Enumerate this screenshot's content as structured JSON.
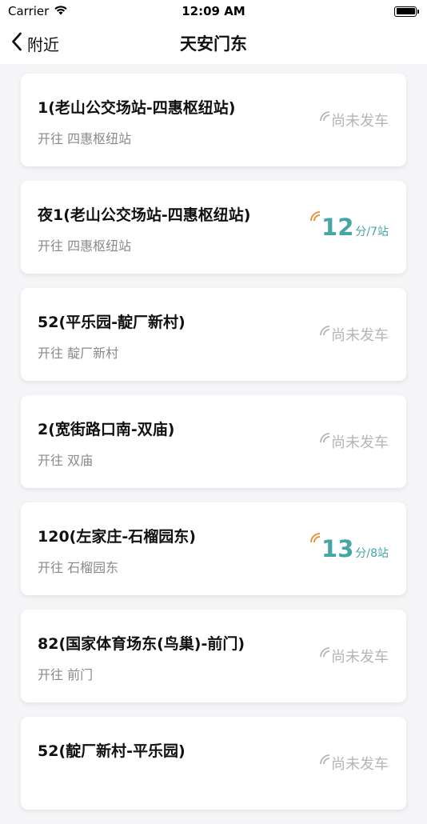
{
  "status_bar": {
    "carrier": "Carrier",
    "time": "12:09 AM"
  },
  "nav": {
    "back_label": "附近",
    "title": "天安门东"
  },
  "colors": {
    "eta": "#45a6a4",
    "signal_active": "#f08a2c",
    "inactive": "#b5b5b5"
  },
  "routes": [
    {
      "name": "1(老山公交场站-四惠枢纽站)",
      "direction": "开往 四惠枢纽站",
      "status": "尚未发车",
      "eta_min": "",
      "eta_unit": ""
    },
    {
      "name": "夜1(老山公交场站-四惠枢纽站)",
      "direction": "开往 四惠枢纽站",
      "status": "",
      "eta_min": "12",
      "eta_unit": "分/7站"
    },
    {
      "name": "52(平乐园-靛厂新村)",
      "direction": "开往 靛厂新村",
      "status": "尚未发车",
      "eta_min": "",
      "eta_unit": ""
    },
    {
      "name": "2(宽街路口南-双庙)",
      "direction": "开往 双庙",
      "status": "尚未发车",
      "eta_min": "",
      "eta_unit": ""
    },
    {
      "name": "120(左家庄-石榴园东)",
      "direction": "开往 石榴园东",
      "status": "",
      "eta_min": "13",
      "eta_unit": "分/8站"
    },
    {
      "name": "82(国家体育场东(鸟巢)-前门)",
      "direction": "开往 前门",
      "status": "尚未发车",
      "eta_min": "",
      "eta_unit": ""
    },
    {
      "name": "52(靛厂新村-平乐园)",
      "direction": "",
      "status": "尚未发车",
      "eta_min": "",
      "eta_unit": ""
    }
  ]
}
